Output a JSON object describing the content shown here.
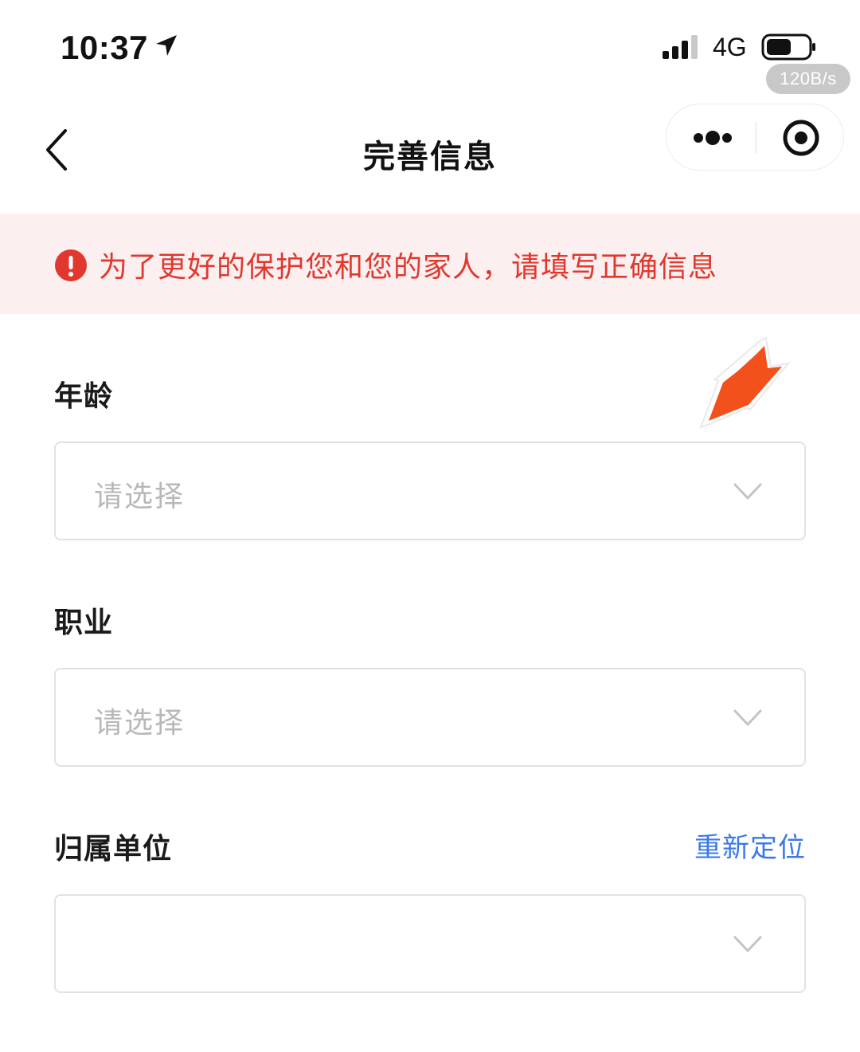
{
  "status_bar": {
    "time": "10:37",
    "network": "4G",
    "speed": "120B/s"
  },
  "nav": {
    "title": "完善信息"
  },
  "banner": {
    "text": "为了更好的保护您和您的家人，请填写正确信息",
    "color": "#e0382f",
    "background": "#fcefef"
  },
  "form": {
    "fields": [
      {
        "label": "年龄",
        "placeholder": "请选择"
      },
      {
        "label": "职业",
        "placeholder": "请选择"
      },
      {
        "label": "归属单位",
        "placeholder": "",
        "action": "重新定位"
      }
    ]
  },
  "colors": {
    "accent_link": "#3b78e7",
    "annotation_arrow": "#f2511b"
  },
  "icons": [
    "location-arrow-icon",
    "signal-icon",
    "battery-icon",
    "back-chevron-icon",
    "more-dots-icon",
    "record-icon",
    "warning-icon",
    "chevron-down-icon",
    "annotation-arrow-icon"
  ]
}
